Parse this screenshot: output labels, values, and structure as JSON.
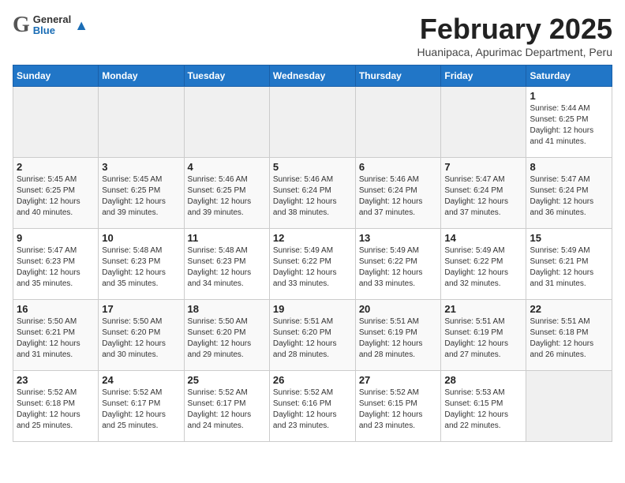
{
  "header": {
    "logo_general": "General",
    "logo_blue": "Blue",
    "month_title": "February 2025",
    "subtitle": "Huanipaca, Apurimac Department, Peru"
  },
  "weekdays": [
    "Sunday",
    "Monday",
    "Tuesday",
    "Wednesday",
    "Thursday",
    "Friday",
    "Saturday"
  ],
  "weeks": [
    [
      {
        "day": "",
        "info": ""
      },
      {
        "day": "",
        "info": ""
      },
      {
        "day": "",
        "info": ""
      },
      {
        "day": "",
        "info": ""
      },
      {
        "day": "",
        "info": ""
      },
      {
        "day": "",
        "info": ""
      },
      {
        "day": "1",
        "info": "Sunrise: 5:44 AM\nSunset: 6:25 PM\nDaylight: 12 hours\nand 41 minutes."
      }
    ],
    [
      {
        "day": "2",
        "info": "Sunrise: 5:45 AM\nSunset: 6:25 PM\nDaylight: 12 hours\nand 40 minutes."
      },
      {
        "day": "3",
        "info": "Sunrise: 5:45 AM\nSunset: 6:25 PM\nDaylight: 12 hours\nand 39 minutes."
      },
      {
        "day": "4",
        "info": "Sunrise: 5:46 AM\nSunset: 6:25 PM\nDaylight: 12 hours\nand 39 minutes."
      },
      {
        "day": "5",
        "info": "Sunrise: 5:46 AM\nSunset: 6:24 PM\nDaylight: 12 hours\nand 38 minutes."
      },
      {
        "day": "6",
        "info": "Sunrise: 5:46 AM\nSunset: 6:24 PM\nDaylight: 12 hours\nand 37 minutes."
      },
      {
        "day": "7",
        "info": "Sunrise: 5:47 AM\nSunset: 6:24 PM\nDaylight: 12 hours\nand 37 minutes."
      },
      {
        "day": "8",
        "info": "Sunrise: 5:47 AM\nSunset: 6:24 PM\nDaylight: 12 hours\nand 36 minutes."
      }
    ],
    [
      {
        "day": "9",
        "info": "Sunrise: 5:47 AM\nSunset: 6:23 PM\nDaylight: 12 hours\nand 35 minutes."
      },
      {
        "day": "10",
        "info": "Sunrise: 5:48 AM\nSunset: 6:23 PM\nDaylight: 12 hours\nand 35 minutes."
      },
      {
        "day": "11",
        "info": "Sunrise: 5:48 AM\nSunset: 6:23 PM\nDaylight: 12 hours\nand 34 minutes."
      },
      {
        "day": "12",
        "info": "Sunrise: 5:49 AM\nSunset: 6:22 PM\nDaylight: 12 hours\nand 33 minutes."
      },
      {
        "day": "13",
        "info": "Sunrise: 5:49 AM\nSunset: 6:22 PM\nDaylight: 12 hours\nand 33 minutes."
      },
      {
        "day": "14",
        "info": "Sunrise: 5:49 AM\nSunset: 6:22 PM\nDaylight: 12 hours\nand 32 minutes."
      },
      {
        "day": "15",
        "info": "Sunrise: 5:49 AM\nSunset: 6:21 PM\nDaylight: 12 hours\nand 31 minutes."
      }
    ],
    [
      {
        "day": "16",
        "info": "Sunrise: 5:50 AM\nSunset: 6:21 PM\nDaylight: 12 hours\nand 31 minutes."
      },
      {
        "day": "17",
        "info": "Sunrise: 5:50 AM\nSunset: 6:20 PM\nDaylight: 12 hours\nand 30 minutes."
      },
      {
        "day": "18",
        "info": "Sunrise: 5:50 AM\nSunset: 6:20 PM\nDaylight: 12 hours\nand 29 minutes."
      },
      {
        "day": "19",
        "info": "Sunrise: 5:51 AM\nSunset: 6:20 PM\nDaylight: 12 hours\nand 28 minutes."
      },
      {
        "day": "20",
        "info": "Sunrise: 5:51 AM\nSunset: 6:19 PM\nDaylight: 12 hours\nand 28 minutes."
      },
      {
        "day": "21",
        "info": "Sunrise: 5:51 AM\nSunset: 6:19 PM\nDaylight: 12 hours\nand 27 minutes."
      },
      {
        "day": "22",
        "info": "Sunrise: 5:51 AM\nSunset: 6:18 PM\nDaylight: 12 hours\nand 26 minutes."
      }
    ],
    [
      {
        "day": "23",
        "info": "Sunrise: 5:52 AM\nSunset: 6:18 PM\nDaylight: 12 hours\nand 25 minutes."
      },
      {
        "day": "24",
        "info": "Sunrise: 5:52 AM\nSunset: 6:17 PM\nDaylight: 12 hours\nand 25 minutes."
      },
      {
        "day": "25",
        "info": "Sunrise: 5:52 AM\nSunset: 6:17 PM\nDaylight: 12 hours\nand 24 minutes."
      },
      {
        "day": "26",
        "info": "Sunrise: 5:52 AM\nSunset: 6:16 PM\nDaylight: 12 hours\nand 23 minutes."
      },
      {
        "day": "27",
        "info": "Sunrise: 5:52 AM\nSunset: 6:15 PM\nDaylight: 12 hours\nand 23 minutes."
      },
      {
        "day": "28",
        "info": "Sunrise: 5:53 AM\nSunset: 6:15 PM\nDaylight: 12 hours\nand 22 minutes."
      },
      {
        "day": "",
        "info": ""
      }
    ]
  ]
}
